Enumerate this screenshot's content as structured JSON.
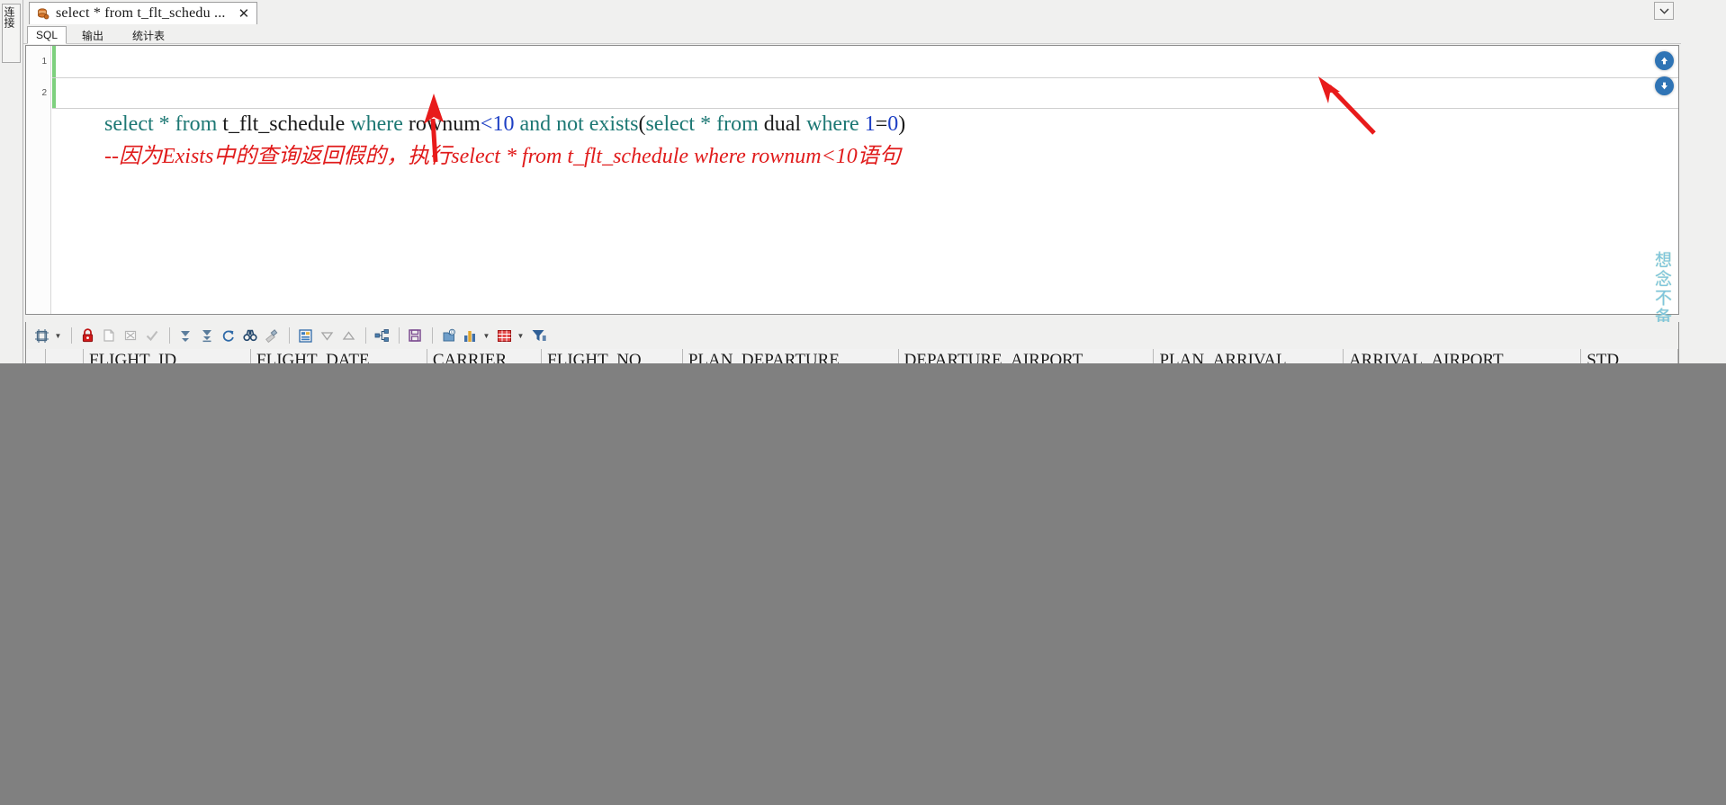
{
  "window": {
    "collapse_icon": "chevron-down-icon"
  },
  "left_dock": {
    "tab_label": "连接"
  },
  "document_tab": {
    "icon": "database-object-icon",
    "label": "select * from t_flt_schedu ...",
    "close_label": "✕"
  },
  "inner_tabs": [
    {
      "label": "SQL",
      "active": true
    },
    {
      "label": "输出",
      "active": false
    },
    {
      "label": "统计表",
      "active": false
    }
  ],
  "editor": {
    "gutter": [
      "1",
      "2"
    ],
    "line1": {
      "tokens": [
        {
          "text": "select",
          "type": "kw"
        },
        {
          "text": " ",
          "type": "plain"
        },
        {
          "text": "*",
          "type": "kw"
        },
        {
          "text": " ",
          "type": "plain"
        },
        {
          "text": "from",
          "type": "kw"
        },
        {
          "text": " ",
          "type": "plain"
        },
        {
          "text": "t_flt_schedule",
          "type": "plain"
        },
        {
          "text": " ",
          "type": "plain"
        },
        {
          "text": "where",
          "type": "kw"
        },
        {
          "text": " ",
          "type": "plain"
        },
        {
          "text": "rownum",
          "type": "plain"
        },
        {
          "text": "<",
          "type": "num"
        },
        {
          "text": "10",
          "type": "num"
        },
        {
          "text": " ",
          "type": "plain"
        },
        {
          "text": "and",
          "type": "kw"
        },
        {
          "text": " ",
          "type": "plain"
        },
        {
          "text": "not",
          "type": "kw"
        },
        {
          "text": " ",
          "type": "plain"
        },
        {
          "text": "exists",
          "type": "kw"
        },
        {
          "text": "(",
          "type": "plain"
        },
        {
          "text": "select",
          "type": "kw"
        },
        {
          "text": " ",
          "type": "plain"
        },
        {
          "text": "*",
          "type": "kw"
        },
        {
          "text": " ",
          "type": "plain"
        },
        {
          "text": "from",
          "type": "kw"
        },
        {
          "text": " ",
          "type": "plain"
        },
        {
          "text": "dual",
          "type": "plain"
        },
        {
          "text": " ",
          "type": "plain"
        },
        {
          "text": "where",
          "type": "kw"
        },
        {
          "text": " ",
          "type": "plain"
        },
        {
          "text": "1",
          "type": "num"
        },
        {
          "text": "=",
          "type": "plain"
        },
        {
          "text": "0",
          "type": "num"
        },
        {
          "text": ")",
          "type": "plain"
        }
      ],
      "plain_text": "select * from t_flt_schedule where rownum<10 and not exists(select * from dual where 1=0)"
    },
    "line2": {
      "comment": "--因为Exists中的查询返回假的，执行select * from t_flt_schedule where rownum<10语句"
    },
    "scroll_up_icon": "arrow-up-circle-icon",
    "scroll_down_icon": "arrow-down-circle-icon"
  },
  "watermark": {
    "text": "想念不备把冰雕"
  },
  "results_toolbar": {
    "buttons": [
      {
        "name": "grid-layout-button",
        "icon": "grid-layout-icon",
        "caret": true
      },
      {
        "name": "lock-button",
        "icon": "lock-red-icon",
        "caret": false
      },
      {
        "name": "insert-record-button",
        "icon": "insert-record-icon",
        "caret": false
      },
      {
        "name": "delete-record-button",
        "icon": "delete-record-icon",
        "caret": false
      },
      {
        "name": "commit-check-button",
        "icon": "check-mark-icon",
        "caret": false
      },
      {
        "name": "fetch-next-button",
        "icon": "fetch-next-icon",
        "caret": false
      },
      {
        "name": "fetch-all-button",
        "icon": "fetch-all-icon",
        "caret": false
      },
      {
        "name": "refresh-button",
        "icon": "refresh-icon",
        "caret": false
      },
      {
        "name": "find-button",
        "icon": "binoculars-icon",
        "caret": false
      },
      {
        "name": "clear-filter-button",
        "icon": "eraser-icon",
        "caret": false
      },
      {
        "name": "single-record-button",
        "icon": "single-record-icon",
        "caret": false
      },
      {
        "name": "sort-desc-button",
        "icon": "triangle-down-icon",
        "caret": false
      },
      {
        "name": "sort-asc-button",
        "icon": "triangle-up-icon",
        "caret": false
      },
      {
        "name": "dependency-button",
        "icon": "hierarchy-icon",
        "caret": false
      },
      {
        "name": "save-button",
        "icon": "floppy-disk-icon",
        "caret": false
      },
      {
        "name": "export-button",
        "icon": "export-icon",
        "caret": false
      },
      {
        "name": "chart-button",
        "icon": "bar-chart-icon",
        "caret": true
      },
      {
        "name": "table-view-button",
        "icon": "table-red-icon",
        "caret": true
      },
      {
        "name": "filter-button",
        "icon": "funnel-icon",
        "caret": false
      }
    ]
  },
  "results_grid": {
    "columns": [
      "FLIGHT_ID",
      "FLIGHT_DATE",
      "CARRIER",
      "FLIGHT_NO",
      "PLAN_DEPARTURE",
      "DEPARTURE_AIRPORT",
      "PLAN_ARRIVAL",
      "ARRIVAL_AIRPORT",
      "STD"
    ]
  },
  "annotations": [
    {
      "name": "annotation-arrow-comment",
      "points_to": "line2-comment"
    },
    {
      "name": "annotation-arrow-exists",
      "points_to": "line1-exists-clause"
    }
  ],
  "colors": {
    "keyword": "#1d7874",
    "number": "#1d3fc4",
    "comment": "#e01b1b",
    "annotation": "#e81b1b",
    "watermark": "#7fc4df",
    "occlusion": "#808080"
  }
}
